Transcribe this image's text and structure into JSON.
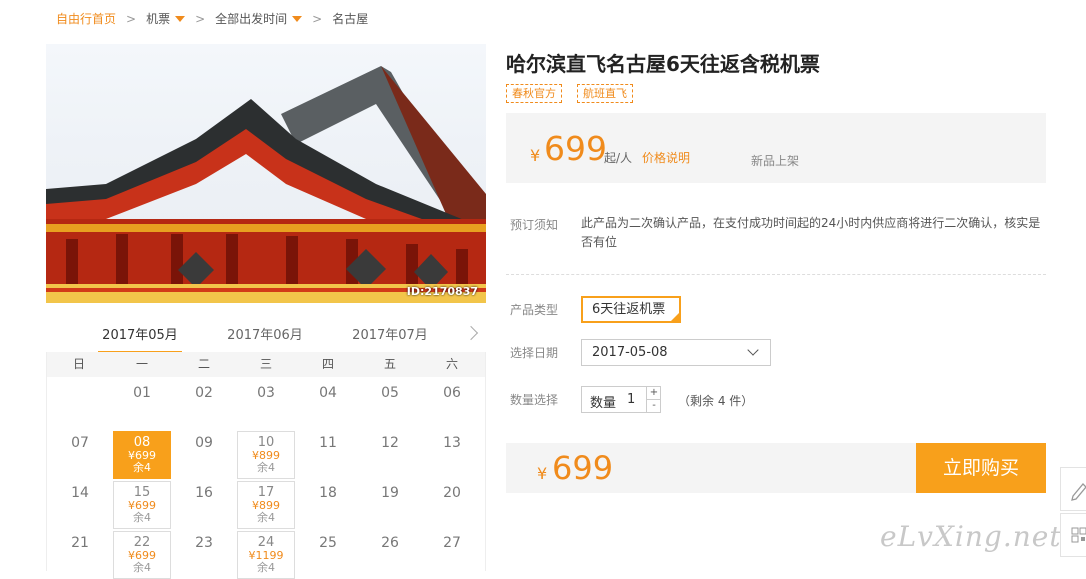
{
  "breadcrumb": {
    "home": "自由行首页",
    "category": "机票",
    "departure": "全部出发时间",
    "destination": "名古屋"
  },
  "hero": {
    "id_label": "ID:2170837"
  },
  "calendar": {
    "months": [
      "2017年05月",
      "2017年06月",
      "2017年07月"
    ],
    "active_month": "2017年05月",
    "weekdays": [
      "日",
      "一",
      "二",
      "三",
      "四",
      "五",
      "六"
    ],
    "days_row1": [
      "01",
      "02",
      "03",
      "04",
      "05",
      "06"
    ],
    "days_row2": [
      "07",
      "08",
      "09",
      "10",
      "11",
      "12",
      "13"
    ],
    "days_row3": [
      "14",
      "15",
      "16",
      "17",
      "18",
      "19",
      "20"
    ],
    "days_row4": [
      "21",
      "22",
      "23",
      "24",
      "25",
      "26",
      "27"
    ],
    "available": {
      "d08": {
        "day": "08",
        "price": "¥699",
        "remain": "余4"
      },
      "d10": {
        "day": "10",
        "price": "¥899",
        "remain": "余4"
      },
      "d15": {
        "day": "15",
        "price": "¥699",
        "remain": "余4"
      },
      "d17": {
        "day": "17",
        "price": "¥899",
        "remain": "余4"
      },
      "d22": {
        "day": "22",
        "price": "¥699",
        "remain": "余4"
      },
      "d24": {
        "day": "24",
        "price": "¥1199",
        "remain": "余4"
      }
    }
  },
  "product": {
    "title": "哈尔滨直飞名古屋6天往返含税机票",
    "tags": [
      "春秋官方",
      "航班直飞"
    ],
    "price_symbol": "¥",
    "price": "699",
    "price_unit": "起/人",
    "price_explain": "价格说明",
    "new_label": "新品上架",
    "notice_label": "预订须知",
    "notice_text": "此产品为二次确认产品，在支付成功时间起的24小时内供应商将进行二次确认，核实是否有位",
    "type_label": "产品类型",
    "type_value": "6天往返机票",
    "date_label": "选择日期",
    "date_value": "2017-05-08",
    "qty_label": "数量选择",
    "qty_inner_label": "数量",
    "qty_value": "1",
    "qty_plus": "+",
    "qty_minus": "-",
    "remaining": "（剩余 4 件）",
    "total_symbol": "¥",
    "total": "699",
    "buy_label": "立即购买"
  },
  "watermark": "eLvXing.net",
  "colors": {
    "accent": "#f8a01b",
    "price": "#f08b1c"
  }
}
